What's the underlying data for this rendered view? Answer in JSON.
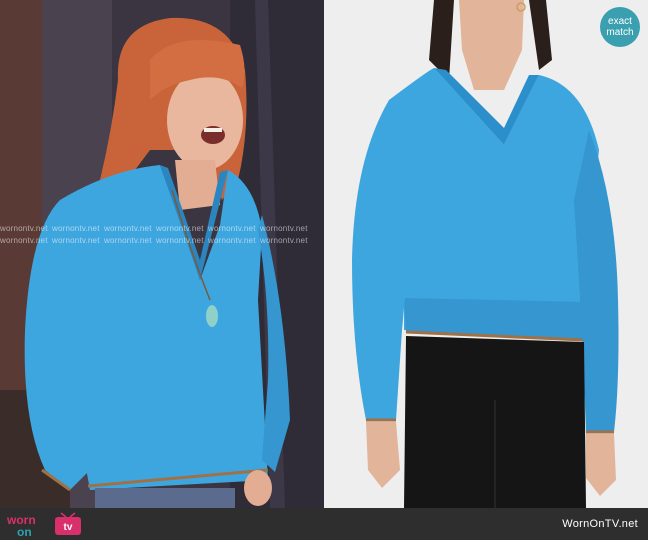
{
  "watermark": {
    "text": "wornontv.net"
  },
  "badge": {
    "line1": "exact",
    "line2": "match"
  },
  "footer": {
    "logo_word_top": "worn",
    "logo_word_bottom": "on",
    "logo_tv": "tv",
    "domain": "WornOnTV.net"
  },
  "colors": {
    "sweater": "#3ea6df",
    "sweater_shadow": "#2b86c0",
    "trim": "#a07046",
    "footer": "#2e2e2e",
    "badge": "#3aa0b0",
    "logo_pink": "#d9306b",
    "logo_teal": "#2ba3b0"
  }
}
